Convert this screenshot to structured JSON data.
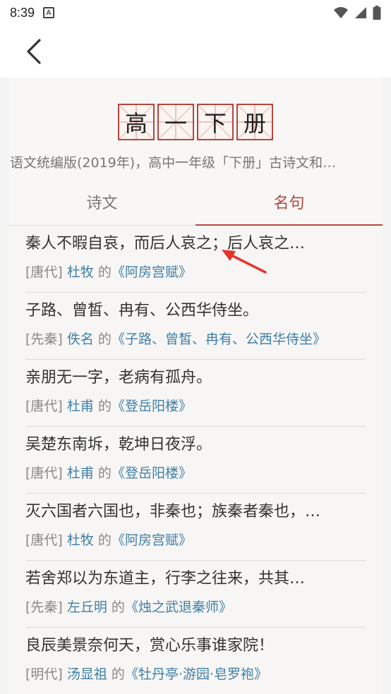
{
  "status_bar": {
    "time": "8:39",
    "notification_icon": "a-box-icon",
    "icons": [
      "wifi-icon",
      "signal-icon",
      "battery-icon"
    ]
  },
  "app_bar": {
    "back_icon": "chevron-left-icon"
  },
  "header": {
    "title_chars": [
      "高",
      "一",
      "下",
      "册"
    ],
    "subtitle": "语文统编版(2019年)，高中一年级「下册」古诗文和…"
  },
  "tabs": [
    {
      "label": "诗文",
      "active": false
    },
    {
      "label": "名句",
      "active": true
    }
  ],
  "quotes": [
    {
      "text": "秦人不暇自哀，而后人哀之；后人哀之…",
      "dynasty": "[唐代]",
      "author": "杜牧",
      "of": " 的",
      "work": "《阿房宫赋》"
    },
    {
      "text": "子路、曾皙、冉有、公西华侍坐。",
      "dynasty": "[先秦]",
      "author": "佚名",
      "of": " 的",
      "work": "《子路、曾皙、冉有、公西华侍坐》"
    },
    {
      "text": "亲朋无一字，老病有孤舟。",
      "dynasty": "[唐代]",
      "author": "杜甫",
      "of": " 的",
      "work": "《登岳阳楼》"
    },
    {
      "text": "吴楚东南坼，乾坤日夜浮。",
      "dynasty": "[唐代]",
      "author": "杜甫",
      "of": " 的",
      "work": "《登岳阳楼》"
    },
    {
      "text": "灭六国者六国也，非秦也；族秦者秦也，…",
      "dynasty": "[唐代]",
      "author": "杜牧",
      "of": " 的",
      "work": "《阿房宫赋》"
    },
    {
      "text": "若舍郑以为东道主，行李之往来，共其…",
      "dynasty": "[先秦]",
      "author": "左丘明",
      "of": " 的",
      "work": "《烛之武退秦师》"
    },
    {
      "text": "良辰美景奈何天，赏心乐事谁家院！",
      "dynasty": "[明代]",
      "author": "汤显祖",
      "of": " 的",
      "work": "《牡丹亭·游园·皂罗袍》"
    }
  ],
  "colors": {
    "accent": "#b4473e",
    "link": "#3f7fa8",
    "arrow": "#e8322c"
  }
}
